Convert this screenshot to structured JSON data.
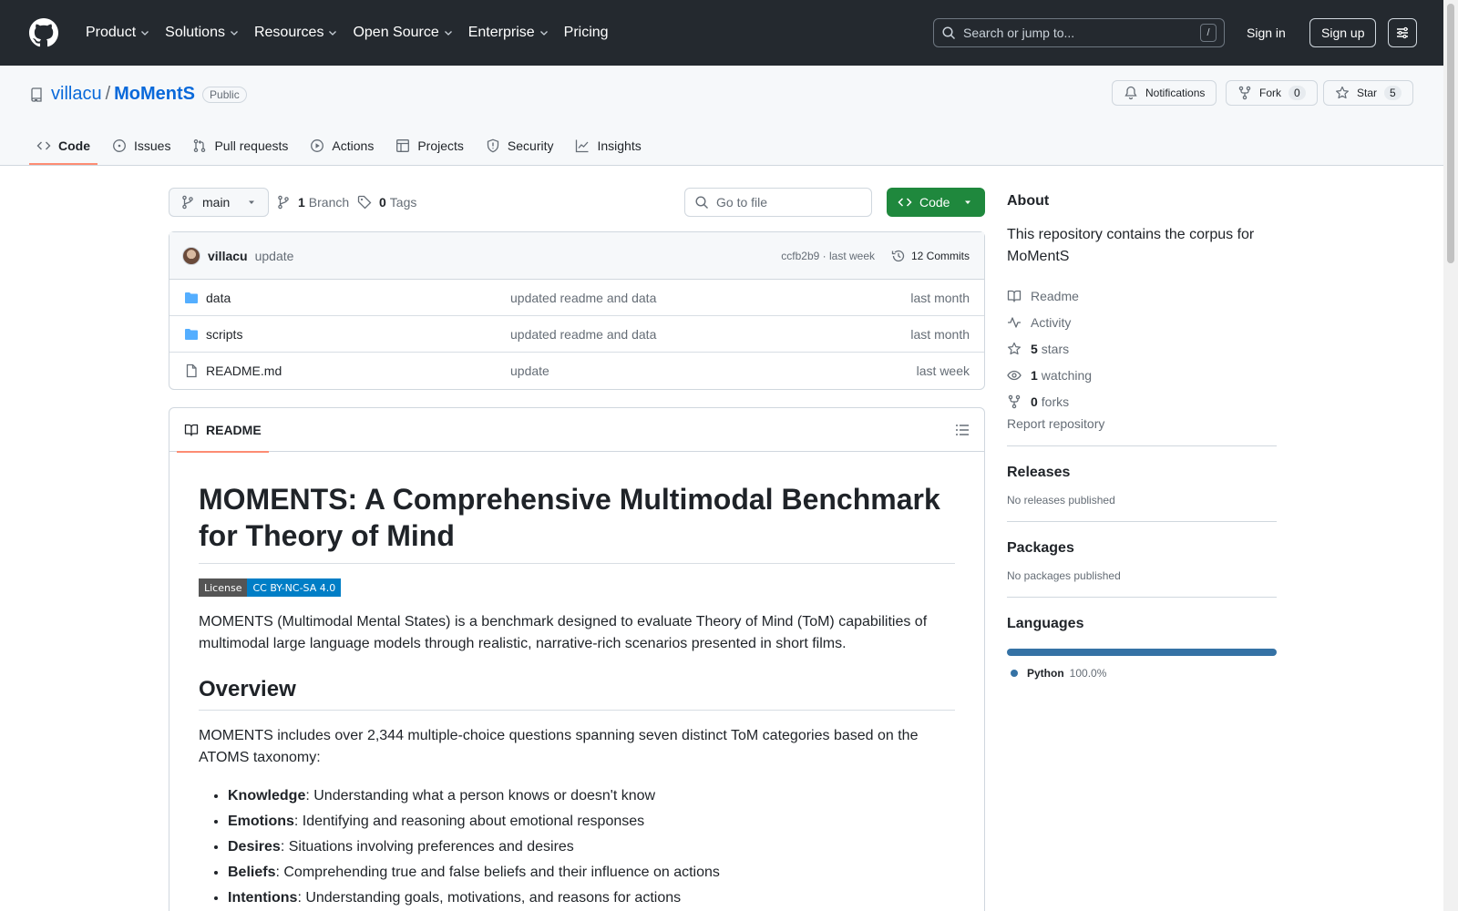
{
  "header": {
    "nav": [
      "Product",
      "Solutions",
      "Resources",
      "Open Source",
      "Enterprise",
      "Pricing"
    ],
    "search_placeholder": "Search or jump to...",
    "search_shortcut": "/",
    "signin": "Sign in",
    "signup": "Sign up"
  },
  "repo": {
    "owner": "villacu",
    "separator": "/",
    "name": "MoMentS",
    "visibility": "Public",
    "notifications": "Notifications",
    "fork_label": "Fork",
    "fork_count": "0",
    "star_label": "Star",
    "star_count": "5",
    "tabs": [
      "Code",
      "Issues",
      "Pull requests",
      "Actions",
      "Projects",
      "Security",
      "Insights"
    ]
  },
  "toolbar": {
    "branch": "main",
    "branch_count": "1",
    "branch_label": "Branch",
    "tag_count": "0",
    "tag_label": "Tags",
    "gofile_placeholder": "Go to file",
    "code_button": "Code"
  },
  "commit": {
    "author": "villacu",
    "message": "update",
    "meta": "ccfb2b9 · last week",
    "commits": "12 Commits"
  },
  "files": [
    {
      "name": "data",
      "type": "folder",
      "commit": "updated readme and data",
      "date": "last month"
    },
    {
      "name": "scripts",
      "type": "folder",
      "commit": "updated readme and data",
      "date": "last month"
    },
    {
      "name": "README.md",
      "type": "file",
      "commit": "update",
      "date": "last week"
    }
  ],
  "readme": {
    "tab": "README",
    "title": "MOMENTS: A Comprehensive Multimodal Benchmark for Theory of Mind",
    "badge_left": "License",
    "badge_right": "CC BY-NC-SA 4.0",
    "intro": "MOMENTS (Multimodal Mental States) is a benchmark designed to evaluate Theory of Mind (ToM) capabilities of multimodal large language models through realistic, narrative-rich scenarios presented in short films.",
    "overview_heading": "Overview",
    "overview_text": "MOMENTS includes over 2,344 multiple-choice questions spanning seven distinct ToM categories based on the ATOMS taxonomy:",
    "items": [
      {
        "term": "Knowledge",
        "desc": ": Understanding what a person knows or doesn't know"
      },
      {
        "term": "Emotions",
        "desc": ": Identifying and reasoning about emotional responses"
      },
      {
        "term": "Desires",
        "desc": ": Situations involving preferences and desires"
      },
      {
        "term": "Beliefs",
        "desc": ": Comprehending true and false beliefs and their influence on actions"
      },
      {
        "term": "Intentions",
        "desc": ": Understanding goals, motivations, and reasons for actions"
      }
    ]
  },
  "sidebar": {
    "about_heading": "About",
    "description": "This repository contains the corpus for MoMentS",
    "readme": "Readme",
    "activity": "Activity",
    "stars_count": "5",
    "stars_label": "stars",
    "watching_count": "1",
    "watching_label": "watching",
    "forks_count": "0",
    "forks_label": "forks",
    "report": "Report repository",
    "releases_heading": "Releases",
    "releases_text": "No releases published",
    "packages_heading": "Packages",
    "packages_text": "No packages published",
    "languages_heading": "Languages",
    "language_name": "Python",
    "language_pct": "100.0%",
    "language_color": "#3572a5"
  }
}
